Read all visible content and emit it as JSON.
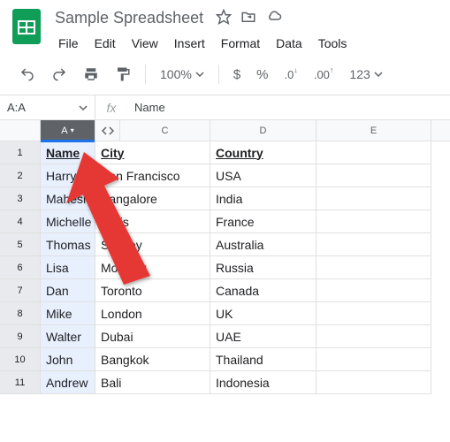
{
  "header": {
    "title": "Sample Spreadsheet",
    "menus": [
      "File",
      "Edit",
      "View",
      "Insert",
      "Format",
      "Data",
      "Tools"
    ]
  },
  "toolbar": {
    "zoom": "100%",
    "currency": "$",
    "percent": "%",
    "dec_dec": ".0",
    "inc_dec": ".00",
    "more_formats": "123"
  },
  "name_box": "A:A",
  "formula_bar": "Name",
  "columns": [
    "A",
    "C",
    "D",
    "E"
  ],
  "selected_column": "A",
  "rows": [
    {
      "n": "1",
      "A": "Name",
      "C": "City",
      "D": "Country",
      "E": ""
    },
    {
      "n": "2",
      "A": "Harry",
      "C": "San Francisco",
      "D": "USA",
      "E": ""
    },
    {
      "n": "3",
      "A": "Mahesh",
      "C": "Bangalore",
      "D": "India",
      "E": ""
    },
    {
      "n": "4",
      "A": "Michelle",
      "C": "Paris",
      "D": "France",
      "E": ""
    },
    {
      "n": "5",
      "A": "Thomas",
      "C": "Sydney",
      "D": "Australia",
      "E": ""
    },
    {
      "n": "6",
      "A": "Lisa",
      "C": "Moscow",
      "D": "Russia",
      "E": ""
    },
    {
      "n": "7",
      "A": "Dan",
      "C": "Toronto",
      "D": "Canada",
      "E": ""
    },
    {
      "n": "8",
      "A": "Mike",
      "C": "London",
      "D": "UK",
      "E": ""
    },
    {
      "n": "9",
      "A": "Walter",
      "C": "Dubai",
      "D": "UAE",
      "E": ""
    },
    {
      "n": "10",
      "A": "John",
      "C": "Bangkok",
      "D": "Thailand",
      "E": ""
    },
    {
      "n": "11",
      "A": "Andrew",
      "C": "Bali",
      "D": "Indonesia",
      "E": ""
    }
  ]
}
